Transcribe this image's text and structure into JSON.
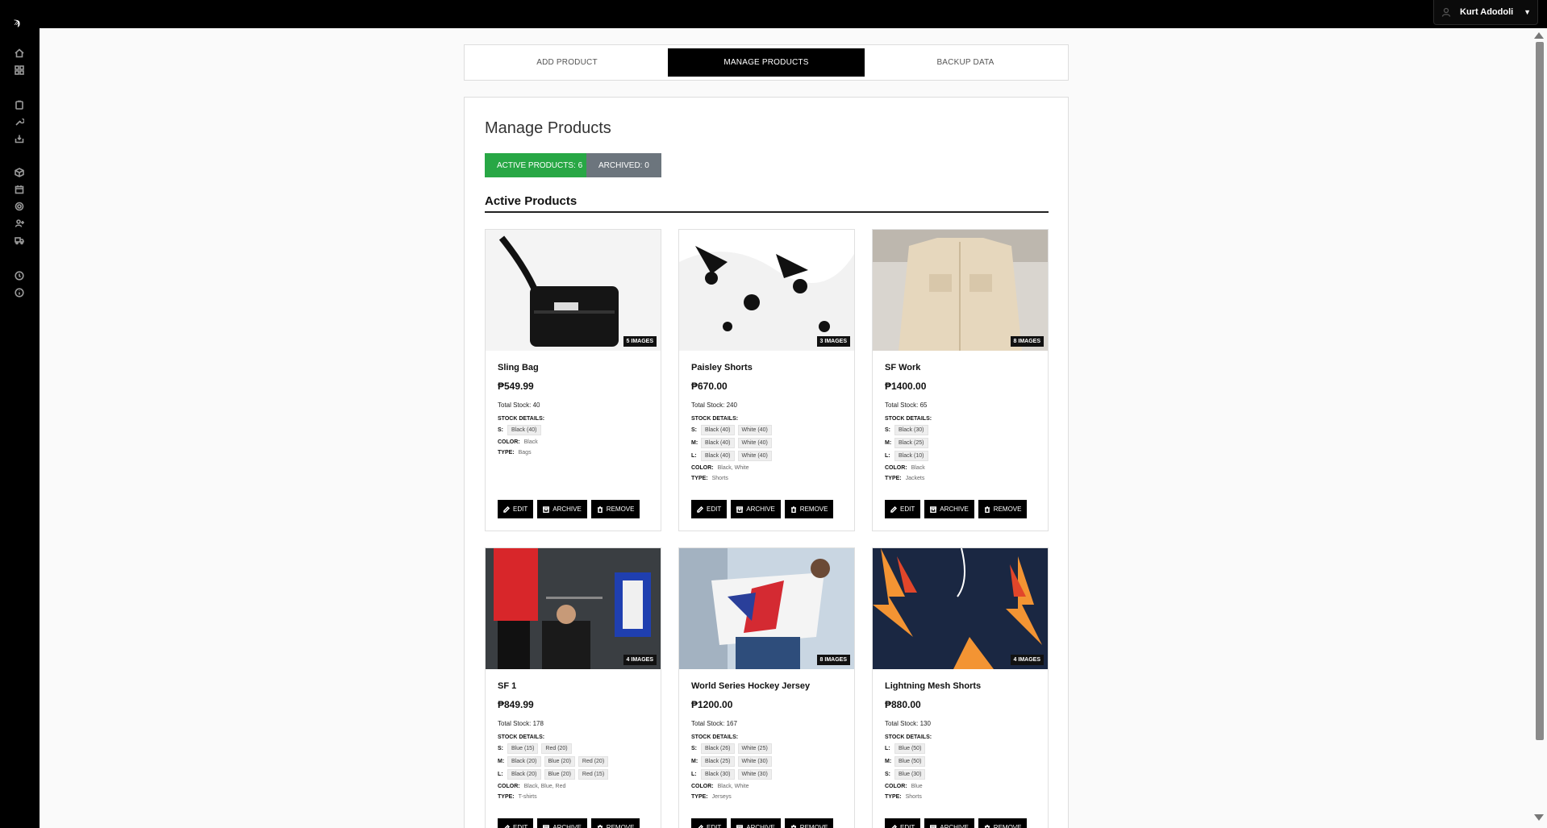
{
  "header": {
    "user_name": "Kurt Adodoli"
  },
  "tabs": [
    {
      "label": "ADD PRODUCT"
    },
    {
      "label": "MANAGE PRODUCTS",
      "active": true
    },
    {
      "label": "BACKUP DATA"
    }
  ],
  "main": {
    "title": "Manage Products",
    "active_count_label": "ACTIVE PRODUCTS: 6",
    "archived_count_label": "ARCHIVED: 0",
    "section_title": "Active Products"
  },
  "labels": {
    "stock_details": "STOCK DETAILS:",
    "color": "COLOR:",
    "type": "TYPE:",
    "edit": "EDIT",
    "archive": "ARCHIVE",
    "remove": "REMOVE"
  },
  "colors": {
    "accent_green": "#28a745",
    "archived_gray": "#6c757d",
    "primary": "#000000"
  },
  "products": [
    {
      "name": "Sling Bag",
      "price": "₱549.99",
      "total_stock": "Total Stock: 40",
      "images": "5 IMAGES",
      "sizes": [
        {
          "size": "S:",
          "chips": [
            "Black (40)"
          ]
        }
      ],
      "color": "Black",
      "type": "Bags"
    },
    {
      "name": "Paisley Shorts",
      "price": "₱670.00",
      "total_stock": "Total Stock: 240",
      "images": "3 IMAGES",
      "sizes": [
        {
          "size": "S:",
          "chips": [
            "Black (40)",
            "White (40)"
          ]
        },
        {
          "size": "M:",
          "chips": [
            "Black (40)",
            "White (40)"
          ]
        },
        {
          "size": "L:",
          "chips": [
            "Black (40)",
            "White (40)"
          ]
        }
      ],
      "color": "Black, White",
      "type": "Shorts"
    },
    {
      "name": "SF Work",
      "price": "₱1400.00",
      "total_stock": "Total Stock: 65",
      "images": "8 IMAGES",
      "sizes": [
        {
          "size": "S:",
          "chips": [
            "Black (30)"
          ]
        },
        {
          "size": "M:",
          "chips": [
            "Black (25)"
          ]
        },
        {
          "size": "L:",
          "chips": [
            "Black (10)"
          ]
        }
      ],
      "color": "Black",
      "type": "Jackets"
    },
    {
      "name": "SF 1",
      "price": "₱849.99",
      "total_stock": "Total Stock: 178",
      "images": "4 IMAGES",
      "sizes": [
        {
          "size": "S:",
          "chips": [
            "Blue (15)",
            "Red (20)"
          ]
        },
        {
          "size": "M:",
          "chips": [
            "Black (20)",
            "Blue (20)",
            "Red (20)"
          ]
        },
        {
          "size": "L:",
          "chips": [
            "Black (20)",
            "Blue (20)",
            "Red (15)"
          ]
        }
      ],
      "color": "Black, Blue, Red",
      "type": "T-shirts"
    },
    {
      "name": "World Series Hockey Jersey",
      "price": "₱1200.00",
      "total_stock": "Total Stock: 167",
      "images": "8 IMAGES",
      "sizes": [
        {
          "size": "S:",
          "chips": [
            "Black (26)",
            "White (25)"
          ]
        },
        {
          "size": "M:",
          "chips": [
            "Black (25)",
            "White (30)"
          ]
        },
        {
          "size": "L:",
          "chips": [
            "Black (30)",
            "White (30)"
          ]
        }
      ],
      "color": "Black, White",
      "type": "Jerseys"
    },
    {
      "name": "Lightning Mesh Shorts",
      "price": "₱880.00",
      "total_stock": "Total Stock: 130",
      "images": "4 IMAGES",
      "sizes": [
        {
          "size": "L:",
          "chips": [
            "Blue (50)"
          ]
        },
        {
          "size": "M:",
          "chips": [
            "Blue (50)"
          ]
        },
        {
          "size": "S:",
          "chips": [
            "Blue (30)"
          ]
        }
      ],
      "color": "Blue",
      "type": "Shorts"
    }
  ]
}
